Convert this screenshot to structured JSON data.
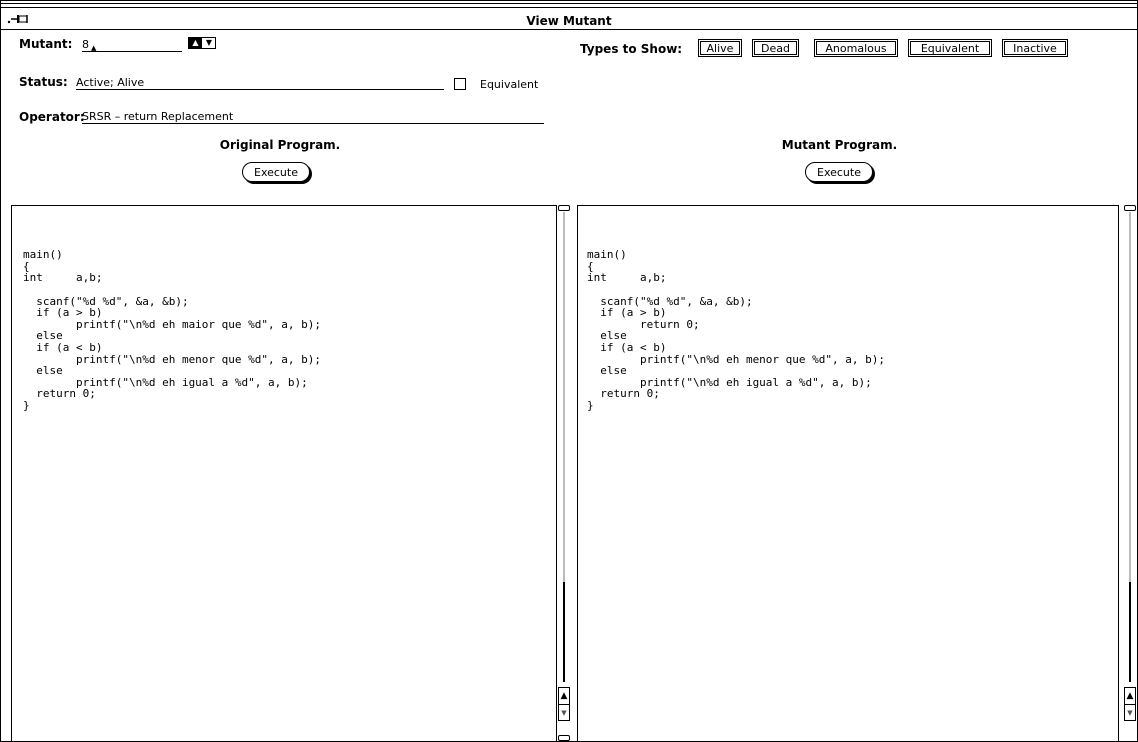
{
  "window": {
    "title": "View Mutant"
  },
  "mutant": {
    "label": "Mutant:",
    "value": "8"
  },
  "status": {
    "label": "Status:",
    "value": "Active; Alive",
    "equivalent_label": "Equivalent"
  },
  "operator": {
    "label": "Operator:",
    "value": "SRSR – return Replacement"
  },
  "types": {
    "label": "Types to Show:",
    "buttons": [
      "Alive",
      "Dead",
      "Anomalous",
      "Equivalent",
      "Inactive"
    ]
  },
  "original": {
    "heading": "Original Program.",
    "execute_label": "Execute",
    "code": "\n\nmain()\n{\nint     a,b;\n\n  scanf(\"%d %d\", &a, &b);\n  if (a > b)\n        printf(\"\\n%d eh maior que %d\", a, b);\n  else\n  if (a < b)\n        printf(\"\\n%d eh menor que %d\", a, b);\n  else\n        printf(\"\\n%d eh igual a %d\", a, b);\n  return 0;\n}"
  },
  "mutated": {
    "heading": "Mutant Program.",
    "execute_label": "Execute",
    "code": "\n\nmain()\n{\nint     a,b;\n\n  scanf(\"%d %d\", &a, &b);\n  if (a > b)\n        return 0;\n  else\n  if (a < b)\n        printf(\"\\n%d eh menor que %d\", a, b);\n  else\n        printf(\"\\n%d eh igual a %d\", a, b);\n  return 0;\n}"
  },
  "icons": {
    "pin": "pushpin-icon",
    "spinner": "spinner-icon",
    "scroll_up": "scroll-up-arrow-icon",
    "scroll_down": "scroll-down-arrow-icon"
  }
}
